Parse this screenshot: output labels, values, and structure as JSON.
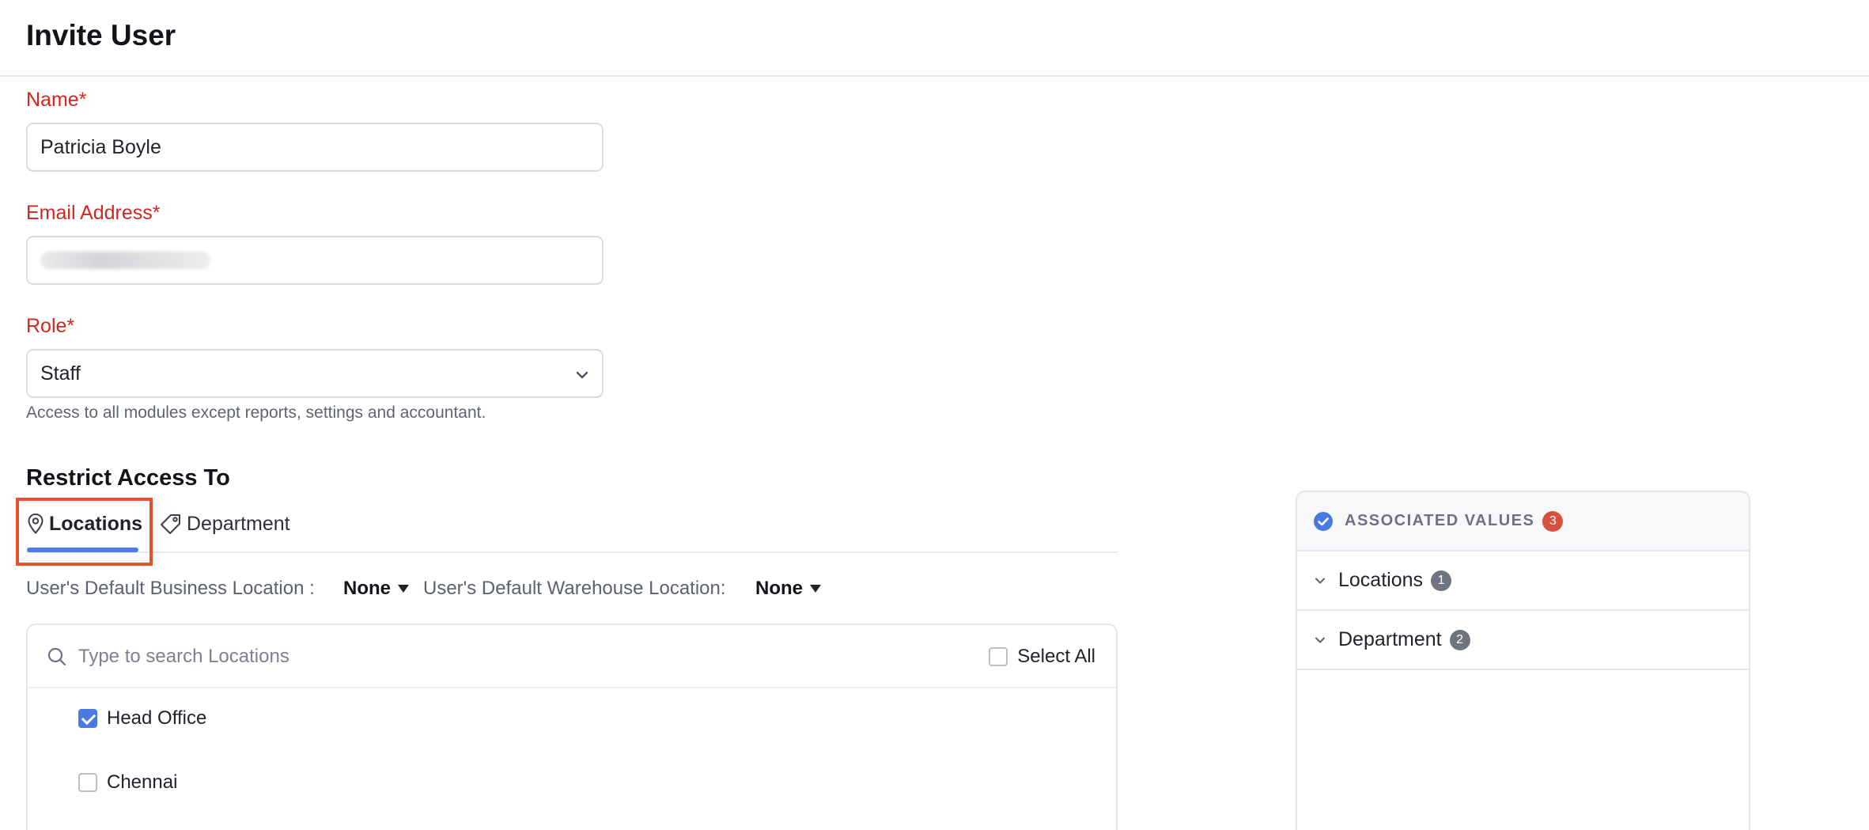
{
  "header": {
    "title": "Invite User"
  },
  "form": {
    "name": {
      "label": "Name*",
      "value": "Patricia Boyle"
    },
    "email": {
      "label": "Email Address*"
    },
    "role": {
      "label": "Role*",
      "value": "Staff",
      "hint": "Access to all modules except reports, settings and accountant."
    }
  },
  "restrict": {
    "title": "Restrict Access To",
    "tabs": [
      {
        "label": "Locations",
        "icon": "location-pin-icon",
        "active": true
      },
      {
        "label": "Department",
        "icon": "tag-icon",
        "active": false
      }
    ],
    "default_business": {
      "label": "User's Default Business Location :",
      "value": "None"
    },
    "default_warehouse": {
      "label": "User's Default Warehouse Location:",
      "value": "None"
    },
    "search": {
      "placeholder": "Type to search Locations"
    },
    "select_all_label": "Select All",
    "locations": [
      {
        "label": "Head Office",
        "checked": true
      },
      {
        "label": "Chennai",
        "checked": false
      }
    ]
  },
  "associated": {
    "title": "ASSOCIATED VALUES",
    "count": "3",
    "rows": [
      {
        "label": "Locations",
        "count": "1"
      },
      {
        "label": "Department",
        "count": "2"
      }
    ]
  },
  "colors": {
    "required_label": "#d0281f",
    "accent": "#4a7ae0",
    "highlight": "#e5502e",
    "badge_red": "#d9503f"
  }
}
